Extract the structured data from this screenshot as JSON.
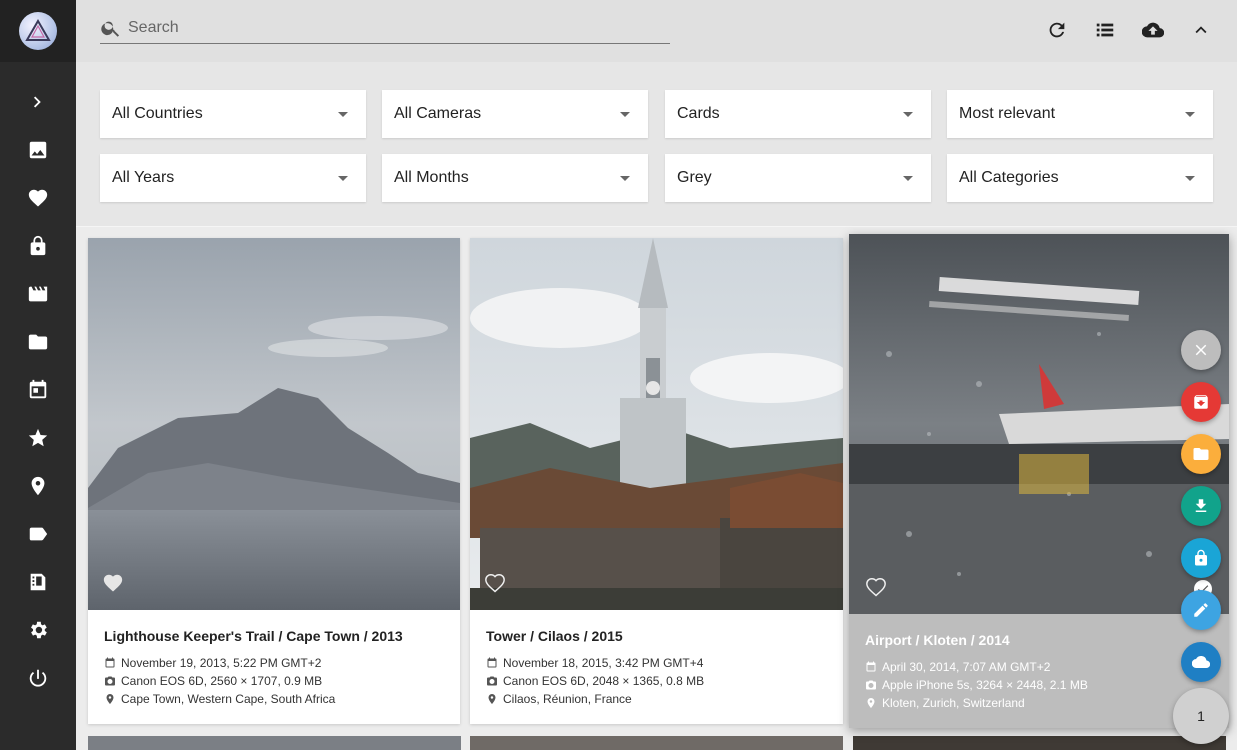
{
  "search": {
    "placeholder": "Search"
  },
  "sidebar": {
    "items": [
      {
        "icon": "chevron-right-icon"
      },
      {
        "icon": "photo-icon"
      },
      {
        "icon": "heart-icon"
      },
      {
        "icon": "lock-icon"
      },
      {
        "icon": "video-icon"
      },
      {
        "icon": "folder-icon"
      },
      {
        "icon": "calendar-icon"
      },
      {
        "icon": "star-icon"
      },
      {
        "icon": "map-pin-icon"
      },
      {
        "icon": "label-icon"
      },
      {
        "icon": "film-folder-icon"
      },
      {
        "icon": "gear-icon"
      },
      {
        "icon": "power-icon"
      }
    ]
  },
  "toolbar": {
    "icons": [
      "refresh-icon",
      "list-view-icon",
      "cloud-upload-icon",
      "chevron-up-icon"
    ]
  },
  "filters": {
    "country": "All Countries",
    "camera": "All Cameras",
    "view": "Cards",
    "sort": "Most relevant",
    "year": "All Years",
    "month": "All Months",
    "color": "Grey",
    "category": "All Categories"
  },
  "photos": [
    {
      "title": "Lighthouse Keeper's Trail / Cape Town / 2013",
      "date": "November 19, 2013, 5:22 PM GMT+2",
      "camera": "Canon EOS 6D, 2560 × 1707, 0.9 MB",
      "location": "Cape Town, Western Cape, South Africa"
    },
    {
      "title": "Tower / Cilaos / 2015",
      "date": "November 18, 2015, 3:42 PM GMT+4",
      "camera": "Canon EOS 6D, 2048 × 1365, 0.8 MB",
      "location": "Cilaos, Réunion, France"
    },
    {
      "title": "Airport / Kloten / 2014",
      "date": "April 30, 2014, 7:07 AM GMT+2",
      "camera": "Apple iPhone 5s, 3264 × 2448, 2.1 MB",
      "location": "Kloten, Zurich, Switzerland",
      "selected": true
    }
  ],
  "fabs": {
    "actions": [
      "close-icon",
      "archive-icon",
      "folder-icon",
      "download-icon",
      "lock-icon",
      "edit-icon",
      "cloud-icon"
    ],
    "colors": {
      "close": "#bdbdbd",
      "archive": "#e53935",
      "folder": "#fbae3c",
      "download": "#11a38b",
      "lock": "#1aa5d6",
      "edit": "#3da4e2",
      "cloud": "#1f7fc4"
    },
    "selection_count": "1"
  }
}
